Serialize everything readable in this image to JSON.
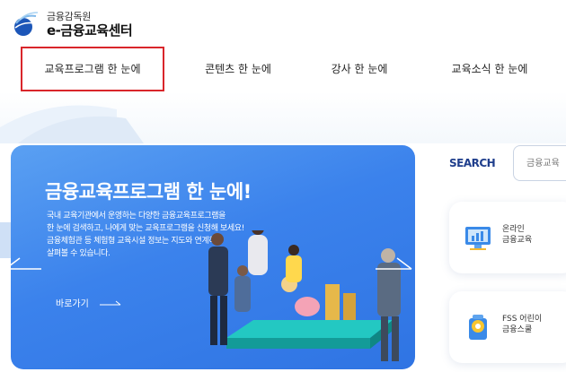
{
  "header": {
    "logo_sub": "금융감독원",
    "logo_main": "e-금융교육센터"
  },
  "nav": {
    "items": [
      {
        "label": "교육프로그램 한 눈에",
        "active": true
      },
      {
        "label": "콘텐츠 한 눈에",
        "active": false
      },
      {
        "label": "강사 한 눈에",
        "active": false
      },
      {
        "label": "교육소식 한 눈에",
        "active": false
      }
    ]
  },
  "hero": {
    "title": "금융교육프로그램 한 눈에!",
    "desc_lines": [
      "국내 교육기관에서 운영하는 다양한 금융교육프로그램을",
      "한 눈에 검색하고, 나에게 맞는 교육프로그램을 신청해 보세요!",
      "금융체험관 등 체험형 교육시설 정보는 지도와 연계하여",
      "살펴볼 수 있습니다."
    ],
    "link_label": "바로가기"
  },
  "search": {
    "label": "SEARCH",
    "placeholder": "금융교육"
  },
  "cards": [
    {
      "line1": "온라인",
      "line2": "금융교육",
      "icon": "monitor-chart-icon"
    },
    {
      "line1": "FSS 어린이",
      "line2": "금융스쿨",
      "icon": "kids-school-icon"
    }
  ],
  "colors": {
    "accent_red": "#d9262b",
    "hero_blue": "#3b82ec",
    "brand_navy": "#1f3e8c"
  }
}
